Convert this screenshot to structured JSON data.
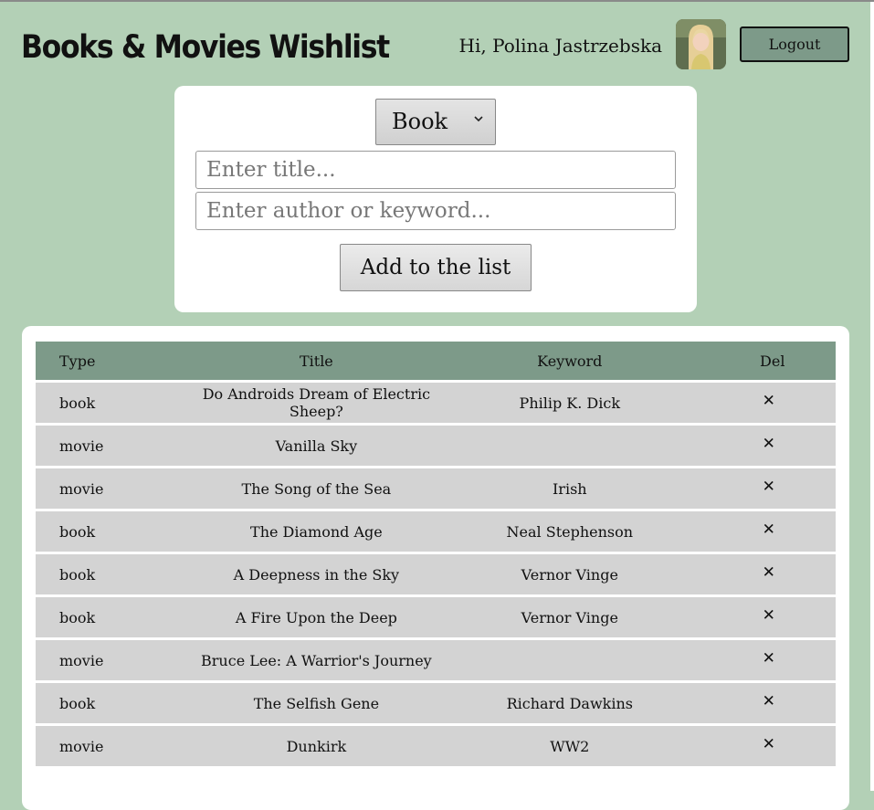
{
  "header": {
    "title": "Books & Movies Wishlist",
    "greeting": "Hi, Polina Jastrzebska",
    "logout_label": "Logout"
  },
  "form": {
    "type_selected": "Book",
    "title_placeholder": "Enter title...",
    "keyword_placeholder": "Enter author or keyword...",
    "add_label": "Add to the list"
  },
  "table": {
    "headers": {
      "type": "Type",
      "title": "Title",
      "keyword": "Keyword",
      "del": "Del"
    },
    "delete_glyph": "✕",
    "rows": [
      {
        "type": "book",
        "title": "Do Androids Dream of Electric Sheep?",
        "keyword": "Philip K. Dick"
      },
      {
        "type": "movie",
        "title": "Vanilla Sky",
        "keyword": ""
      },
      {
        "type": "movie",
        "title": "The Song of the Sea",
        "keyword": "Irish"
      },
      {
        "type": "book",
        "title": "The Diamond Age",
        "keyword": "Neal Stephenson"
      },
      {
        "type": "book",
        "title": "A Deepness in the Sky",
        "keyword": "Vernor Vinge"
      },
      {
        "type": "book",
        "title": "A Fire Upon the Deep",
        "keyword": "Vernor Vinge"
      },
      {
        "type": "movie",
        "title": "Bruce Lee: A Warrior's Journey",
        "keyword": ""
      },
      {
        "type": "book",
        "title": "The Selfish Gene",
        "keyword": "Richard Dawkins"
      },
      {
        "type": "movie",
        "title": "Dunkirk",
        "keyword": "WW2"
      }
    ]
  },
  "colors": {
    "page_background": "#b3d0b6",
    "accent": "#7d9a89",
    "row_background": "#d3d3d3",
    "card_background": "#ffffff"
  },
  "icons": {
    "select_arrow": "chevron-down-icon",
    "delete": "close-icon",
    "avatar": "user-avatar"
  }
}
